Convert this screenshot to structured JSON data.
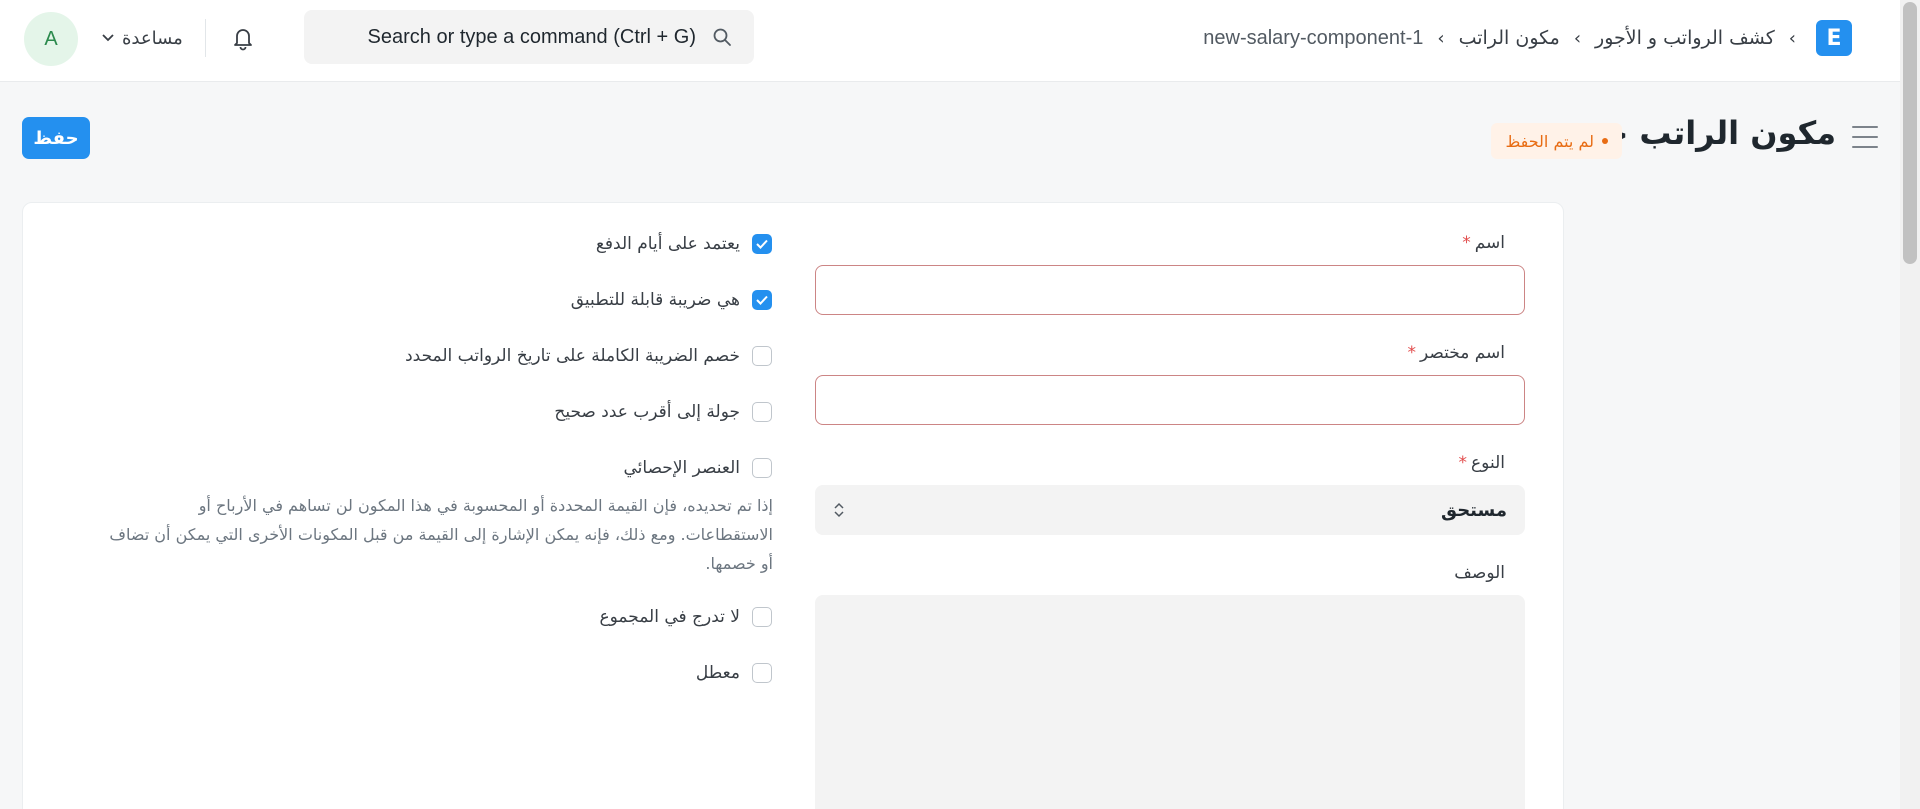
{
  "navbar": {
    "logo_letter": "E",
    "breadcrumbs": [
      "كشف الرواتب و الأجور",
      "مكون الراتب",
      "new-salary-component-1"
    ],
    "breadcrumb_separator": "›",
    "search_placeholder": "Search or type a command (Ctrl + G)",
    "help_label": "مساعدة",
    "avatar_initial": "A"
  },
  "page": {
    "title": "مكون الراتب جديد",
    "status": "لم يتم الحفظ",
    "save_label": "حفظ"
  },
  "form": {
    "name": {
      "label": "اسم",
      "required_mark": "*",
      "value": ""
    },
    "abbr": {
      "label": "اسم مختصر",
      "required_mark": "*",
      "value": ""
    },
    "type": {
      "label": "النوع",
      "required_mark": "*",
      "value": "مستحق"
    },
    "description": {
      "label": "الوصف",
      "value": ""
    },
    "checkboxes": [
      {
        "label": "يعتمد على أيام الدفع",
        "checked": true
      },
      {
        "label": "هي ضريبة قابلة للتطبيق",
        "checked": true
      },
      {
        "label": "خصم الضريبة الكاملة على تاريخ الرواتب المحدد",
        "checked": false
      },
      {
        "label": "جولة إلى أقرب عدد صحيح",
        "checked": false
      },
      {
        "label": "العنصر الإحصائي",
        "checked": false
      },
      {
        "label": "لا تدرج في المجموع",
        "checked": false
      },
      {
        "label": "معطل",
        "checked": false
      }
    ],
    "statistical_help": "إذا تم تحديده، فإن القيمة المحددة أو المحسوبة في هذا المكون لن تساهم في الأرباح أو الاستقطاعات. ومع ذلك، فإنه يمكن الإشارة إلى القيمة من قبل المكونات الأخرى التي يمكن أن تضاف أو خصمها."
  },
  "colors": {
    "primary": "#2490ef",
    "status_orange": "#e86c13",
    "required_red": "#e24c4c"
  }
}
